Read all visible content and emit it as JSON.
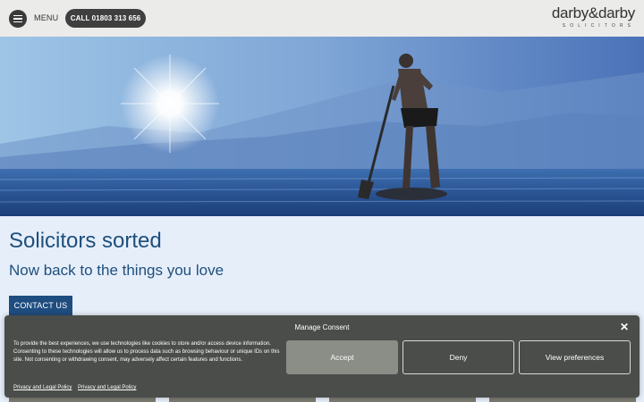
{
  "header": {
    "menu_label": "MENU",
    "call_label": "CALL 01803 313 656",
    "logo_main": "darby&darby",
    "logo_sub": "SOLICITORS"
  },
  "main": {
    "heading": "Solicitors sorted",
    "subheading": "Now back to the things you love",
    "cta_label": "CONTACT US"
  },
  "consent": {
    "title": "Manage Consent",
    "body": "To provide the best experiences, we use technologies like cookies to store and/or access device information. Consenting to these technologies will allow us to process data such as browsing behaviour or unique IDs on this site. Not consenting or withdrawing consent, may adversely affect certain features and functions.",
    "accept_label": "Accept",
    "deny_label": "Deny",
    "prefs_label": "View preferences",
    "links": [
      "Privacy and Legal Policy",
      "Privacy and Legal Policy"
    ]
  },
  "icons": {
    "menu": "hamburger-icon",
    "close": "close-icon"
  },
  "colors": {
    "brand_blue": "#1e4f7c",
    "consent_bg": "#4a4d4a",
    "accept_bg": "#8a8e86"
  }
}
